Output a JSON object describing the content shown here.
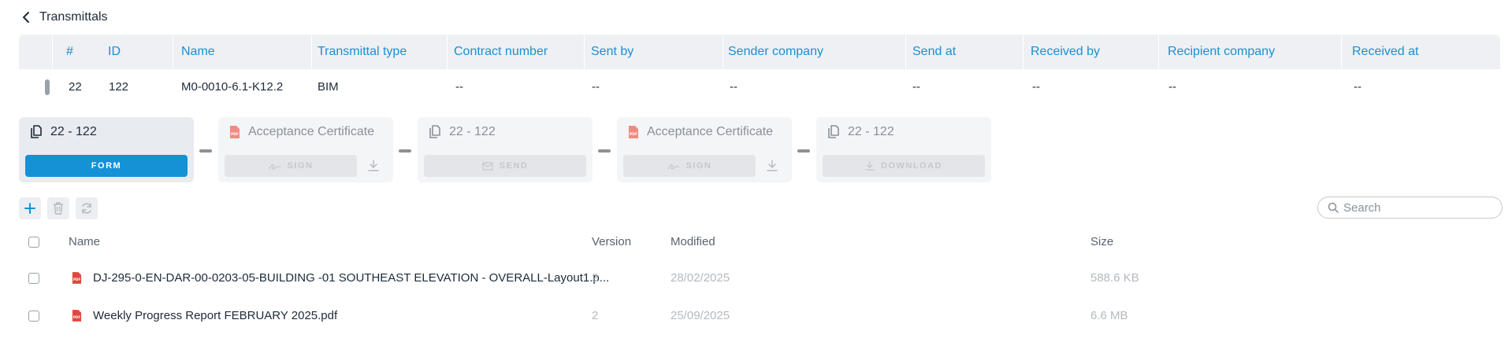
{
  "header": {
    "back_label": "Transmittals"
  },
  "transmittals_table": {
    "columns": [
      "#",
      "ID",
      "Name",
      "Transmittal type",
      "Contract number",
      "Sent by",
      "Sender company",
      "Send at",
      "Received by",
      "Recipient company",
      "Received at"
    ],
    "row": [
      "22",
      "122",
      "M0-0010-6.1-K12.2",
      "BIM",
      "--",
      "--",
      "--",
      "--",
      "--",
      "--",
      "--"
    ]
  },
  "workflow": {
    "steps": [
      {
        "title": "22 - 122",
        "button": "FORM",
        "icon": "document-icon"
      },
      {
        "title": "Acceptance Certificate",
        "button": "SIGN",
        "icon": "pdf-icon"
      },
      {
        "title": "22 - 122",
        "button": "SEND",
        "icon": "document-icon"
      },
      {
        "title": "Acceptance Certificate",
        "button": "SIGN",
        "icon": "pdf-icon"
      },
      {
        "title": "22 - 122",
        "button": "DOWNLOAD",
        "icon": "document-icon"
      }
    ]
  },
  "toolbar": {
    "search_placeholder": "Search"
  },
  "files": {
    "columns": {
      "name": "Name",
      "version": "Version",
      "modified": "Modified",
      "size": "Size"
    },
    "rows": [
      {
        "name": "DJ-295-0-EN-DAR-00-0203-05-BUILDING -01 SOUTHEAST ELEVATION - OVERALL-Layout1.p...",
        "version": "2",
        "modified": "28/02/2025",
        "size": "588.6 KB"
      },
      {
        "name": "Weekly Progress Report FEBRUARY 2025.pdf",
        "version": "2",
        "modified": "25/09/2025",
        "size": "6.6 MB"
      }
    ]
  },
  "colors": {
    "accent": "#1591d6",
    "pdf": "#e0483c",
    "header_bg": "#eef0f3"
  }
}
